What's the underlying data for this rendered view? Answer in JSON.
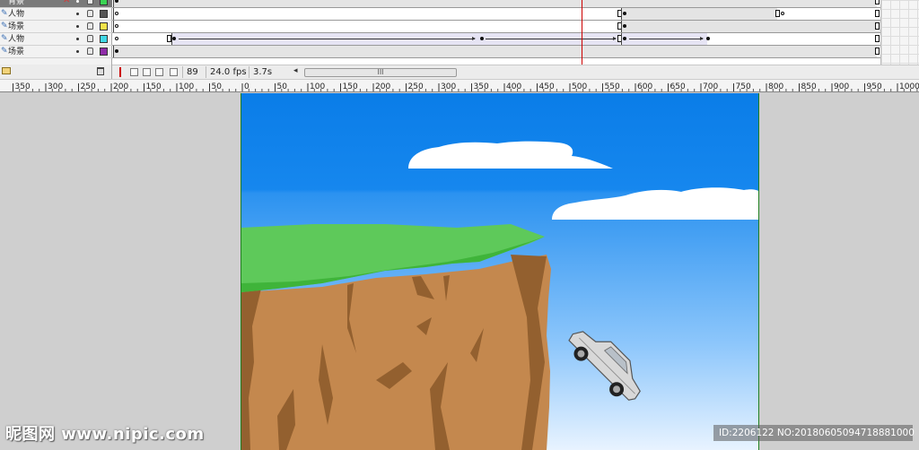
{
  "timeline": {
    "layers": [
      {
        "name": "背景",
        "active": true,
        "color": "#39d353"
      },
      {
        "name": "人物",
        "active": false,
        "color": "#555555"
      },
      {
        "name": "场景",
        "active": false,
        "color": "#f3e34a"
      },
      {
        "name": "人物",
        "active": false,
        "color": "#3fd7e6"
      },
      {
        "name": "场景",
        "active": false,
        "color": "#8e2ca8"
      }
    ],
    "current_frame": "89",
    "fps": "24.0 fps",
    "time": "3.7s",
    "scroll_grip": "III"
  },
  "ruler": {
    "labels": [
      "350",
      "300",
      "250",
      "200",
      "150",
      "100",
      "50",
      "0",
      "50",
      "100",
      "150",
      "200",
      "250",
      "300",
      "350",
      "400",
      "450",
      "500",
      "550",
      "600",
      "650",
      "700",
      "750",
      "800",
      "850",
      "900",
      "950",
      "1000"
    ]
  },
  "stage": {
    "sky_top_color": "#0a7de8",
    "sky_bottom_color": "#e8f3ff",
    "grass_color": "#5ec95a",
    "cliff_color": "#c4884e",
    "cliff_shadow_color": "#93602f"
  },
  "watermark": {
    "logo": "昵图网 www.nipic.com",
    "id_text": "ID:2206122 NO:20180605094718881000"
  }
}
